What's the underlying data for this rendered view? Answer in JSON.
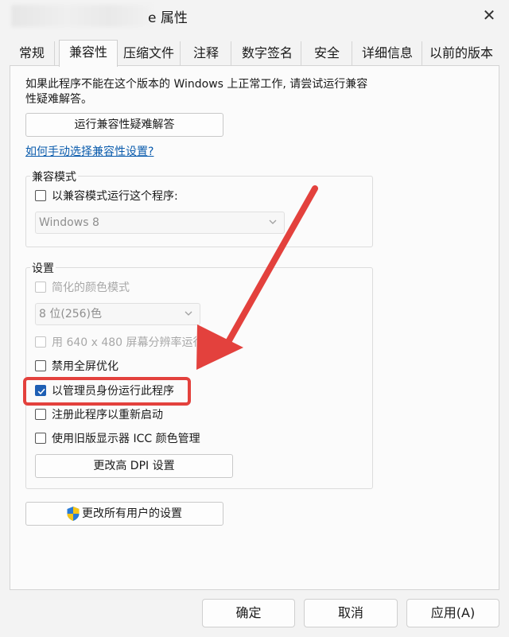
{
  "window": {
    "title_suffix": "e 属性",
    "close_glyph": "✕"
  },
  "tabs": [
    {
      "label": "常规"
    },
    {
      "label": "兼容性"
    },
    {
      "label": "压缩文件"
    },
    {
      "label": "注释"
    },
    {
      "label": "数字签名"
    },
    {
      "label": "安全"
    },
    {
      "label": "详细信息"
    },
    {
      "label": "以前的版本"
    }
  ],
  "compat": {
    "description_line1": "如果此程序不能在这个版本的 Windows 上正常工作, 请尝试运行兼容",
    "description_line2": "性疑难解答。",
    "troubleshooter_button": "运行兼容性疑难解答",
    "manual_link": "如何手动选择兼容性设置?",
    "mode_group_label": "兼容模式",
    "mode_checkbox_label": "以兼容模式运行这个程序:",
    "mode_select_value": "Windows 8",
    "settings_group_label": "设置",
    "reduced_color_label": "简化的颜色模式",
    "color_select_value": "8 位(256)色",
    "resolution_label": "用 640 x 480 屏幕分辨率运行",
    "disable_fullscreen_label": "禁用全屏优化",
    "run_as_admin_label": "以管理员身份运行此程序",
    "register_restart_label": "注册此程序以重新启动",
    "legacy_icc_label": "使用旧版显示器 ICC 颜色管理",
    "dpi_button": "更改高 DPI 设置",
    "all_users_button": "更改所有用户的设置",
    "run_as_admin_checked": true
  },
  "footer": {
    "ok": "确定",
    "cancel": "取消",
    "apply": "应用(A)"
  },
  "colors": {
    "accent": "#1e5fb4",
    "annotation_red": "#e3413d",
    "link": "#0b5cad"
  }
}
